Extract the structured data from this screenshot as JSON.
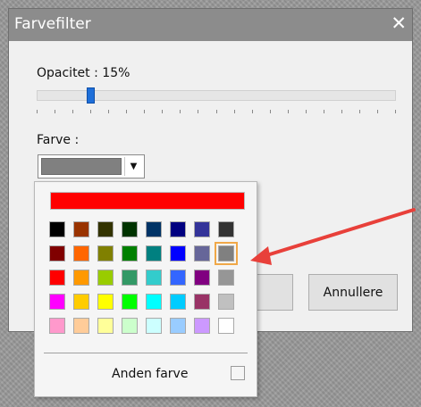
{
  "dialog": {
    "title": "Farvefilter",
    "close_glyph": "✕",
    "opacity_label": "Opacitet : 15%",
    "opacity_value_percent": 15,
    "color_label": "Farve :",
    "selected_color": "#808080",
    "ok_label": "",
    "cancel_label": "Annullere"
  },
  "palette": {
    "top_color": "#ff0000",
    "colors": [
      [
        "#000000",
        "#993300",
        "#333300",
        "#003300",
        "#003366",
        "#000080",
        "#333399",
        "#333333"
      ],
      [
        "#800000",
        "#ff6600",
        "#808000",
        "#008000",
        "#008080",
        "#0000ff",
        "#666699",
        "#808080"
      ],
      [
        "#ff0000",
        "#ff9900",
        "#99cc00",
        "#339966",
        "#33cccc",
        "#3366ff",
        "#800080",
        "#969696"
      ],
      [
        "#ff00ff",
        "#ffcc00",
        "#ffff00",
        "#00ff00",
        "#00ffff",
        "#00ccff",
        "#993366",
        "#c0c0c0"
      ],
      [
        "#ff99cc",
        "#ffcc99",
        "#ffff99",
        "#ccffcc",
        "#ccffff",
        "#99ccff",
        "#cc99ff",
        "#ffffff"
      ]
    ],
    "selected_index": [
      1,
      7
    ],
    "custom_label": "Anden farve"
  },
  "annotation": {
    "arrow_color": "#e8403a"
  }
}
